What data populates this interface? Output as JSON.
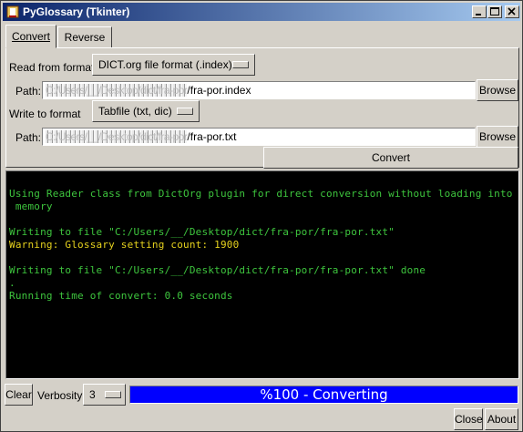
{
  "window": {
    "title": "PyGlossary (Tkinter)",
    "icons": [
      "app-icon",
      "minimize-icon",
      "maximize-icon",
      "close-icon"
    ]
  },
  "tabs": [
    {
      "label": "Convert",
      "active": true
    },
    {
      "label": "Reverse",
      "active": false
    }
  ],
  "convert": {
    "read_label": "Read from format",
    "read_format": "DICT.org file format (.index)",
    "path_label": "Path:",
    "input_path_hidden": "C:/Users/__/Desktop/dict/fra-por",
    "input_path_visible": "/fra-por.index",
    "browse_label": "Browse",
    "write_label": "Write to format",
    "write_format": "Tabfile (txt, dic)",
    "output_path_hidden": "C:/Users/__/Desktop/dict/fra-por",
    "output_path_visible": "/fra-por.txt",
    "convert_label": "Convert"
  },
  "log": [
    {
      "text": "Using Reader class from DictOrg plugin for direct conversion without loading into",
      "color": "green"
    },
    {
      "text": " memory",
      "color": "green"
    },
    {
      "text": "",
      "color": "green"
    },
    {
      "text": "Writing to file \"C:/Users/__/Desktop/dict/fra-por/fra-por.txt\"",
      "color": "green"
    },
    {
      "text": "Warning: Glossary setting count: 1900",
      "color": "yellow"
    },
    {
      "text": "",
      "color": "green"
    },
    {
      "text": "Writing to file \"C:/Users/__/Desktop/dict/fra-por/fra-por.txt\" done",
      "color": "green"
    },
    {
      "text": ".",
      "color": "green"
    },
    {
      "text": "Running time of convert: 0.0 seconds",
      "color": "green"
    }
  ],
  "footer": {
    "clear_label": "Clear",
    "verbosity_label": "Verbosity",
    "verbosity_value": "3",
    "progress_text": "%100 - Converting",
    "progress_percent": 100,
    "close_label": "Close",
    "about_label": "About"
  },
  "colors": {
    "title_start": "#0a246a",
    "title_end": "#a6caf0",
    "progress": "#0000ff",
    "log_green": "#3ec63e",
    "log_yellow": "#e6d21e"
  }
}
